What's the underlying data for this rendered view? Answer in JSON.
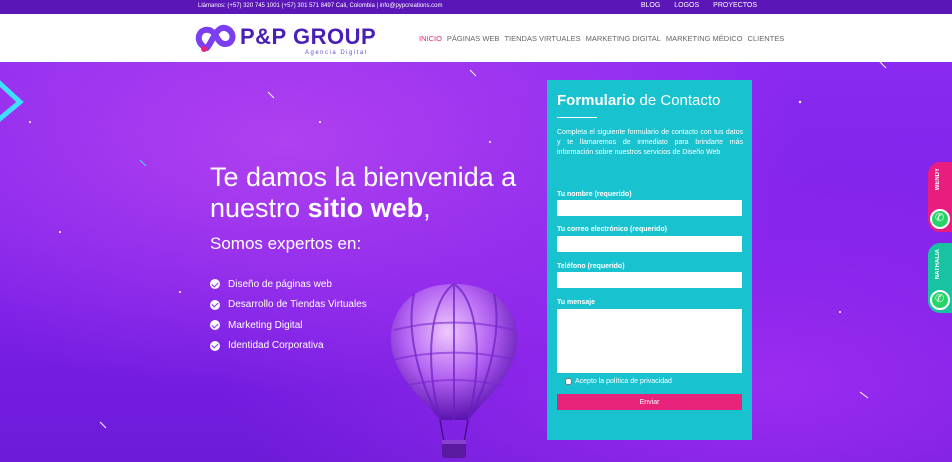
{
  "topbar": {
    "contact": "Llámanos: (+57) 320 745 1001 (+57) 301 571 8497 Cali, Colombia | info@pypcreations.com",
    "links": [
      "BLOG",
      "LOGOS",
      "PROYECTOS"
    ]
  },
  "header": {
    "logo_name": "P&P GROUP",
    "logo_tagline": "Agencia Digital",
    "nav": [
      "INICIO",
      "PÁGINAS WEB",
      "TIENDAS VIRTUALES",
      "MARKETING DIGITAL",
      "MARKETING MÉDICO",
      "CLIENTES"
    ]
  },
  "hero": {
    "welcome_line1": "Te damos la bienvenida a",
    "welcome_line2_pre": "nuestro ",
    "welcome_line2_bold": "sitio web",
    "welcome_line2_post": ",",
    "subtitle": "Somos expertos en:",
    "services": [
      "Diseño de páginas web",
      "Desarrollo de Tiendas Virtuales",
      "Marketing Digital",
      "Identidad Corporativa"
    ]
  },
  "form": {
    "title_bold": "Formulario",
    "title_rest": " de Contacto",
    "description": "Completa el siguiente formulario de contacto con tus datos y te llamaremos de inmediato para brindarte más información sobre nuestros servicios de Diseño Web",
    "name_label": "Tu nombre (requerido)",
    "email_label": "Tu correo electrónico (requerido)",
    "phone_label": "Teléfono (requerido)",
    "message_label": "Tu mensaje",
    "privacy_label": "Acepto la política de privacidad",
    "submit_label": "Enviar"
  },
  "side_tabs": [
    {
      "label": "WENDY",
      "color": "#e81d7e"
    },
    {
      "label": "NATHALIA",
      "color": "#19c2a0"
    }
  ],
  "colors": {
    "accent": "#e81d7e",
    "form_bg": "#19c2cf",
    "hero_bg": "#7a1fe6",
    "brand": "#4a1fb8"
  }
}
